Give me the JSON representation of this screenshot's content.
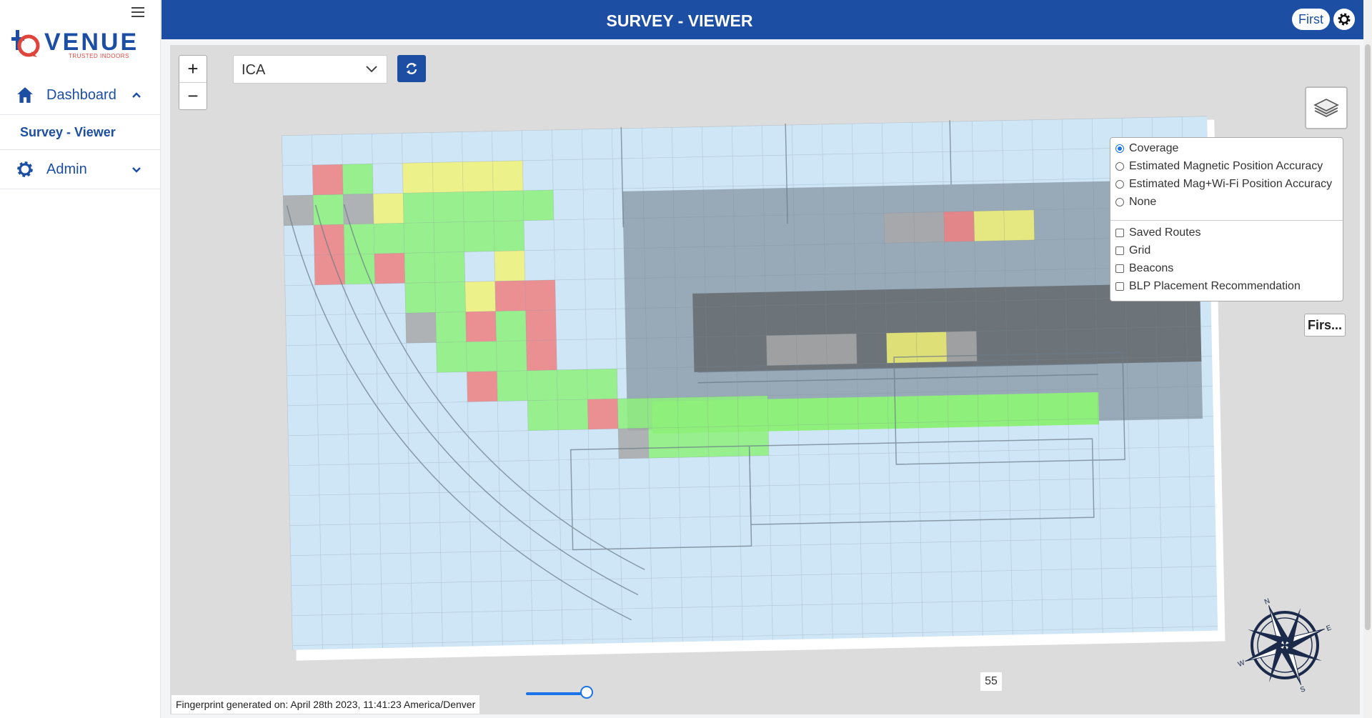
{
  "sidebar": {
    "menu_icon": "hamburger-icon",
    "logo": {
      "wordmark": "VENUE",
      "tagline": "TRUSTED INDOORS"
    },
    "items": [
      {
        "label": "Dashboard",
        "icon": "home-icon",
        "expanded": true
      },
      {
        "label": "Survey - Viewer",
        "active": true
      },
      {
        "label": "Admin",
        "icon": "gear-icon",
        "expanded": false
      }
    ]
  },
  "header": {
    "title": "SURVEY - VIEWER",
    "floor_button": "First",
    "settings_icon": "gear-icon"
  },
  "map": {
    "zoom_in": "+",
    "zoom_out": "−",
    "floor_select": {
      "value": "ICA"
    },
    "refresh_icon": "refresh-icon",
    "layers_icon": "layers-icon",
    "layer_options": {
      "radios": [
        {
          "label": "Coverage",
          "checked": true
        },
        {
          "label": "Estimated Magnetic Position Accuracy",
          "checked": false
        },
        {
          "label": "Estimated Mag+Wi-Fi Position Accuracy",
          "checked": false
        },
        {
          "label": "None",
          "checked": false
        }
      ],
      "checkboxes": [
        {
          "label": "Saved Routes",
          "checked": false
        },
        {
          "label": "Grid",
          "checked": false
        },
        {
          "label": "Beacons",
          "checked": false
        },
        {
          "label": "BLP Placement Recommendation",
          "checked": false
        }
      ]
    },
    "floor_label": "Firs...",
    "compass_icon": "compass-rose-icon",
    "compass_letters": {
      "n": "N",
      "e": "E",
      "s": "S",
      "w": "W"
    },
    "footer": "Fingerprint generated on: April 28th 2023, 11:41:23 America/Denver",
    "slider": {
      "value": 55,
      "fraction": 0.135,
      "label": "55"
    }
  },
  "colors": {
    "brand": "#1c4ea3",
    "accent": "#1a73e8",
    "coverage_base": "#cfe6f7",
    "good": "#8ef07a",
    "medium": "#f2f276",
    "poor": "#f08080",
    "no_data": "#a8a8a8"
  }
}
